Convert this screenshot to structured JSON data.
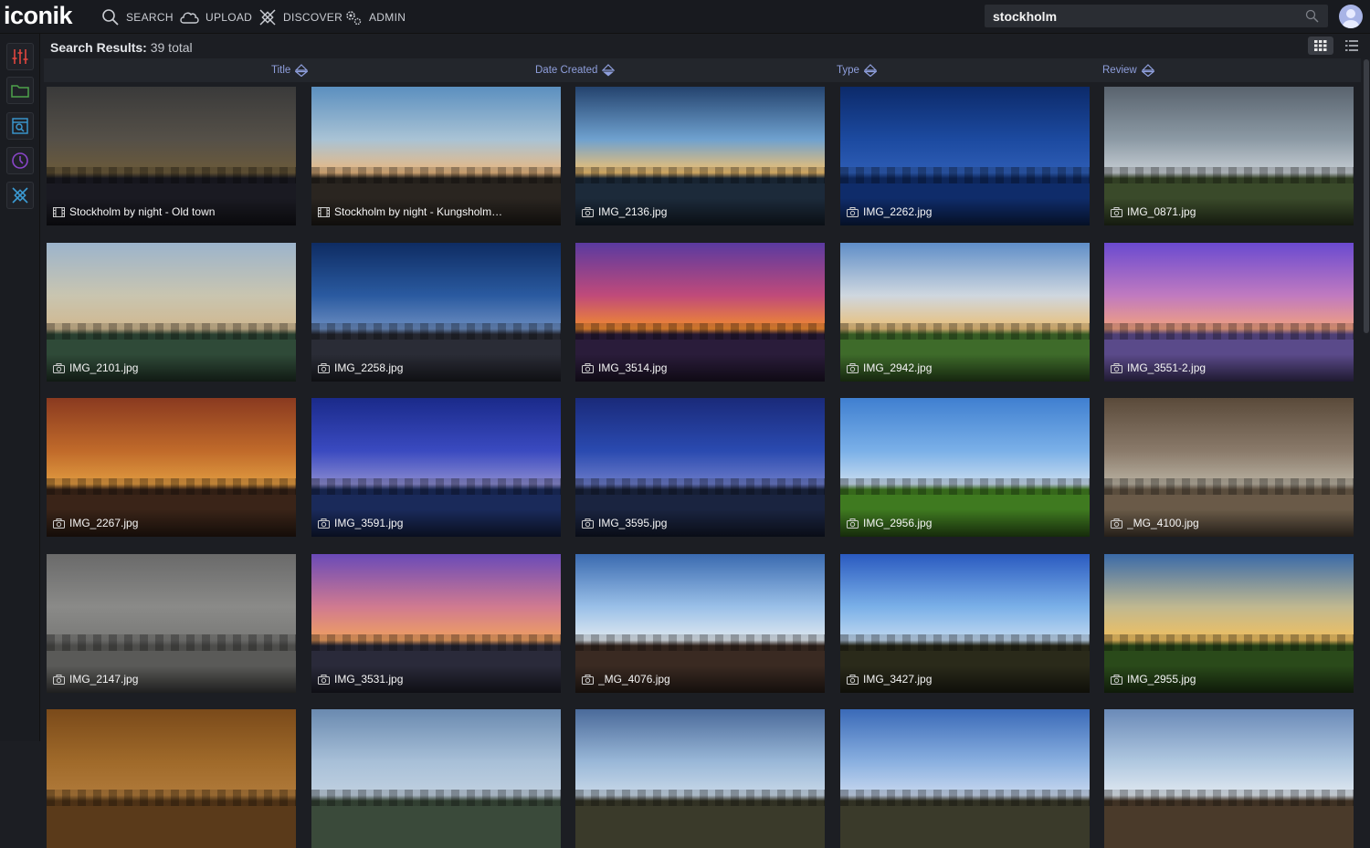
{
  "app": {
    "logo": "iconik",
    "nav": [
      {
        "label": "SEARCH",
        "icon": "search-icon"
      },
      {
        "label": "UPLOAD",
        "icon": "cloud-icon"
      },
      {
        "label": "DISCOVER",
        "icon": "discover-icon"
      },
      {
        "label": "ADMIN",
        "icon": "gears-icon"
      }
    ],
    "search": {
      "value": "stockholm"
    }
  },
  "sidebar": [
    {
      "name": "sliders",
      "color": "#e0463f"
    },
    {
      "name": "folder",
      "color": "#4ea24a"
    },
    {
      "name": "collection-search",
      "color": "#3b9bd4"
    },
    {
      "name": "history",
      "color": "#8a46c9"
    },
    {
      "name": "discover",
      "color": "#3b9bd4"
    }
  ],
  "results": {
    "label": "Search Results:",
    "count": "39 total"
  },
  "sort_columns": [
    "Title",
    "Date Created",
    "Type",
    "Review"
  ],
  "colors": {
    "accent": "#8f9fdd",
    "background": "#1c1e23"
  },
  "assets": [
    {
      "title": "Stockholm by night - Old town",
      "type": "video",
      "sky": [
        "#3a3a3a",
        "#555048",
        "#6b5a3a"
      ],
      "ground": "#1a1a22"
    },
    {
      "title": "Stockholm by night - Kungsholm…",
      "type": "video",
      "sky": [
        "#5b8fbf",
        "#a9c3d5",
        "#e9b880"
      ],
      "ground": "#2a2520"
    },
    {
      "title": "IMG_2136.jpg",
      "type": "image",
      "sky": [
        "#24436e",
        "#6fa1cf",
        "#f0c070"
      ],
      "ground": "#1c2a3a"
    },
    {
      "title": "IMG_2262.jpg",
      "type": "image",
      "sky": [
        "#0c2a6a",
        "#1c4aa0",
        "#2e5db5"
      ],
      "ground": "#0f2c6a"
    },
    {
      "title": "IMG_0871.jpg",
      "type": "image",
      "sky": [
        "#59636e",
        "#8c9aa5",
        "#c5ccd2"
      ],
      "ground": "#3a4a2a"
    },
    {
      "title": "IMG_2101.jpg",
      "type": "image",
      "sky": [
        "#9cb4cc",
        "#c9c5b0",
        "#d0b890"
      ],
      "ground": "#2f4a38"
    },
    {
      "title": "IMG_2258.jpg",
      "type": "image",
      "sky": [
        "#0e2c63",
        "#2a5aa0",
        "#6a8cc0"
      ],
      "ground": "#2a2c36"
    },
    {
      "title": "IMG_3514.jpg",
      "type": "image",
      "sky": [
        "#5a3aa0",
        "#c04a7a",
        "#f08a30"
      ],
      "ground": "#2a1c3a"
    },
    {
      "title": "IMG_2942.jpg",
      "type": "image",
      "sky": [
        "#5f8ec8",
        "#cfd7df",
        "#e9c07a"
      ],
      "ground": "#3e6b2a"
    },
    {
      "title": "IMG_3551-2.jpg",
      "type": "image",
      "sky": [
        "#6a4ad0",
        "#c07ac0",
        "#f0a080"
      ],
      "ground": "#5a4a8a"
    },
    {
      "title": "IMG_2267.jpg",
      "type": "image",
      "sky": [
        "#8a3a20",
        "#c06a2a",
        "#e09a40"
      ],
      "ground": "#3a2418"
    },
    {
      "title": "IMG_3591.jpg",
      "type": "image",
      "sky": [
        "#1a2a8a",
        "#3a4ac0",
        "#8a8ad0"
      ],
      "ground": "#1a2a5a"
    },
    {
      "title": "IMG_3595.jpg",
      "type": "image",
      "sky": [
        "#1a2a7a",
        "#2a4ab0",
        "#6a7ac8"
      ],
      "ground": "#1a2440"
    },
    {
      "title": "IMG_2956.jpg",
      "type": "image",
      "sky": [
        "#3f7fd0",
        "#7ab0e8",
        "#c8dcef"
      ],
      "ground": "#3f7a20"
    },
    {
      "title": "_MG_4100.jpg",
      "type": "image",
      "sky": [
        "#5a4a3a",
        "#8a7a6a",
        "#b8b0a0"
      ],
      "ground": "#6a5a48"
    },
    {
      "title": "IMG_2147.jpg",
      "type": "image",
      "sky": [
        "#6a6a6a",
        "#8a8a88",
        "#7a7a78"
      ],
      "ground": "#5a5a58"
    },
    {
      "title": "IMG_3531.jpg",
      "type": "image",
      "sky": [
        "#6a4ab8",
        "#d07a90",
        "#f0a060"
      ],
      "ground": "#2a2a3a"
    },
    {
      "title": "_MG_4076.jpg",
      "type": "image",
      "sky": [
        "#3a6ab0",
        "#9ac0e8",
        "#dfe8f0"
      ],
      "ground": "#3a2a22"
    },
    {
      "title": "IMG_3427.jpg",
      "type": "image",
      "sky": [
        "#2a5ac0",
        "#7ab0e8",
        "#c0d8f0"
      ],
      "ground": "#2a2a1a"
    },
    {
      "title": "IMG_2955.jpg",
      "type": "image",
      "sky": [
        "#3a6aa8",
        "#c0b890",
        "#f0c060"
      ],
      "ground": "#2a4a1a"
    },
    {
      "title": "",
      "type": "image",
      "sky": [
        "#7a4a1a",
        "#a06a2a",
        "#b07a3a"
      ],
      "ground": "#5a3a1a"
    },
    {
      "title": "",
      "type": "image",
      "sky": [
        "#6a8ab0",
        "#a8c0d8",
        "#c0d0e0"
      ],
      "ground": "#3a4a3a"
    },
    {
      "title": "",
      "type": "image",
      "sky": [
        "#4a6a9a",
        "#9ab8d8",
        "#c8d8e8"
      ],
      "ground": "#3a3a2a"
    },
    {
      "title": "",
      "type": "image",
      "sky": [
        "#3a6ab8",
        "#8ab0e0",
        "#c8d8ef"
      ],
      "ground": "#3a3a2a"
    },
    {
      "title": "",
      "type": "image",
      "sky": [
        "#6a8ab8",
        "#b0c8e0",
        "#e0e8f0"
      ],
      "ground": "#4a3a2a"
    }
  ]
}
